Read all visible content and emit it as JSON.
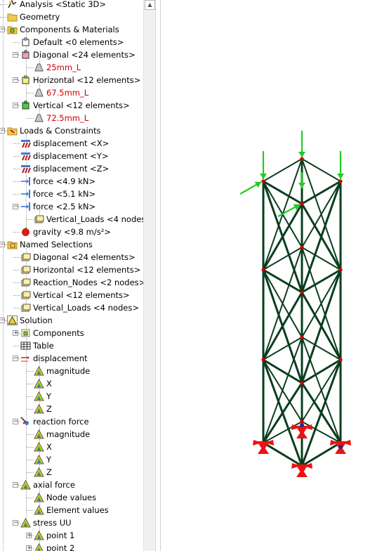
{
  "colors": {
    "member": "#0a3d1e",
    "node": "#cc0000",
    "support": "#ee1111",
    "load_arrow": "#22cc22",
    "label_red": "#cc0000"
  },
  "tree": [
    {
      "label": "Analysis <Static 3D>",
      "icon": "analysis-icon",
      "level": 0,
      "exp": null
    },
    {
      "label": "Geometry",
      "icon": "folder-icon",
      "level": 0,
      "exp": null
    },
    {
      "label": "Components & Materials",
      "icon": "folder-component-icon",
      "level": 0,
      "exp": "minus"
    },
    {
      "label": "Default <0 elements>",
      "icon": "component-default-icon",
      "level": 1,
      "exp": null
    },
    {
      "label": "Diagonal <24 elements>",
      "icon": "component-diagonal-icon",
      "level": 1,
      "exp": "minus"
    },
    {
      "label": "25mm_L",
      "icon": "angle-section-icon",
      "level": 2,
      "exp": null,
      "red": true
    },
    {
      "label": "Horizontal <12 elements>",
      "icon": "component-horizontal-icon",
      "level": 1,
      "exp": "minus"
    },
    {
      "label": "67.5mm_L",
      "icon": "angle-section-icon",
      "level": 2,
      "exp": null,
      "red": true
    },
    {
      "label": "Vertical <12 elements>",
      "icon": "component-vertical-icon",
      "level": 1,
      "exp": "minus"
    },
    {
      "label": "72.5mm_L",
      "icon": "angle-section-icon",
      "level": 2,
      "exp": null,
      "red": true
    },
    {
      "label": "Loads & Constraints",
      "icon": "folder-loads-icon",
      "level": 0,
      "exp": "minus"
    },
    {
      "label": "displacement <X>",
      "icon": "displacement-constraint-icon",
      "level": 1,
      "exp": null
    },
    {
      "label": "displacement <Y>",
      "icon": "displacement-constraint-icon",
      "level": 1,
      "exp": null
    },
    {
      "label": "displacement <Z>",
      "icon": "displacement-constraint-icon",
      "level": 1,
      "exp": null
    },
    {
      "label": "force <4.9 kN>",
      "icon": "force-icon",
      "level": 1,
      "exp": null
    },
    {
      "label": "force <5.1 kN>",
      "icon": "force-icon",
      "level": 1,
      "exp": null
    },
    {
      "label": "force <2.5 kN>",
      "icon": "force-icon",
      "level": 1,
      "exp": "minus"
    },
    {
      "label": "Vertical_Loads <4 nodes>",
      "icon": "selection-icon",
      "level": 2,
      "exp": null
    },
    {
      "label": "gravity <9.8 m/s²>",
      "icon": "gravity-icon",
      "level": 1,
      "exp": null
    },
    {
      "label": "Named Selections",
      "icon": "folder-selections-icon",
      "level": 0,
      "exp": "minus"
    },
    {
      "label": "Diagonal <24 elements>",
      "icon": "selection-icon",
      "level": 1,
      "exp": null
    },
    {
      "label": "Horizontal <12 elements>",
      "icon": "selection-icon",
      "level": 1,
      "exp": null
    },
    {
      "label": "Reaction_Nodes <2 nodes>",
      "icon": "selection-icon",
      "level": 1,
      "exp": null
    },
    {
      "label": "Vertical <12 elements>",
      "icon": "selection-icon",
      "level": 1,
      "exp": null
    },
    {
      "label": "Vertical_Loads <4 nodes>",
      "icon": "selection-icon",
      "level": 1,
      "exp": null
    },
    {
      "label": "Solution",
      "icon": "solution-icon",
      "level": 0,
      "exp": "minus"
    },
    {
      "label": "Components",
      "icon": "components-icon",
      "level": 1,
      "exp": "plus"
    },
    {
      "label": "Table",
      "icon": "table-icon",
      "level": 1,
      "exp": null
    },
    {
      "label": "displacement",
      "icon": "displacement-result-icon",
      "level": 1,
      "exp": "minus"
    },
    {
      "label": "magnitude",
      "icon": "result-icon",
      "level": 2,
      "exp": null
    },
    {
      "label": "X",
      "icon": "result-icon",
      "level": 2,
      "exp": null
    },
    {
      "label": "Y",
      "icon": "result-icon",
      "level": 2,
      "exp": null
    },
    {
      "label": "Z",
      "icon": "result-icon",
      "level": 2,
      "exp": null
    },
    {
      "label": "reaction force",
      "icon": "reaction-force-icon",
      "level": 1,
      "exp": "minus"
    },
    {
      "label": "magnitude",
      "icon": "result-icon",
      "level": 2,
      "exp": null
    },
    {
      "label": "X",
      "icon": "result-icon",
      "level": 2,
      "exp": null
    },
    {
      "label": "Y",
      "icon": "result-icon",
      "level": 2,
      "exp": null
    },
    {
      "label": "Z",
      "icon": "result-icon",
      "level": 2,
      "exp": null
    },
    {
      "label": "axial force",
      "icon": "result-icon",
      "level": 1,
      "exp": "minus"
    },
    {
      "label": "Node values",
      "icon": "result-icon",
      "level": 2,
      "exp": null
    },
    {
      "label": "Element values",
      "icon": "result-icon",
      "level": 2,
      "exp": null
    },
    {
      "label": "stress UU",
      "icon": "result-icon",
      "level": 1,
      "exp": "minus"
    },
    {
      "label": "point 1",
      "icon": "result-icon",
      "level": 2,
      "exp": "plus"
    },
    {
      "label": "point 2",
      "icon": "result-icon",
      "level": 2,
      "exp": "plus"
    }
  ]
}
